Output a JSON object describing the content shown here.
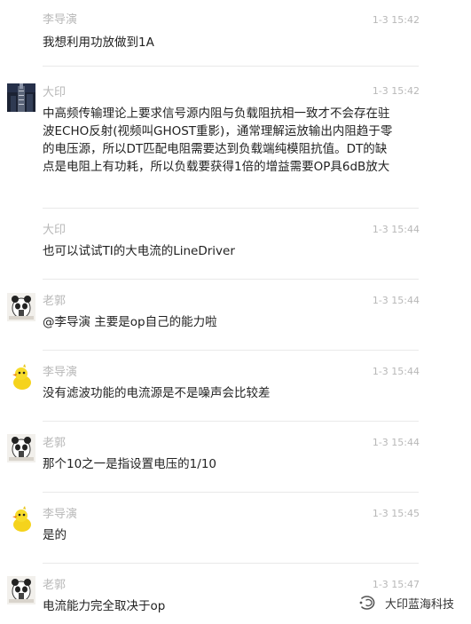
{
  "messages": [
    {
      "name": "李导演",
      "time": "1-3 15:42",
      "text": "我想利用功放做到1A",
      "avatar": "none"
    },
    {
      "name": "大印",
      "time": "1-3 15:42",
      "text": "中高频传输理论上要求信号源内阻与负载阻抗相一致才不会存在驻波ECHO反射(视频叫GHOST重影)，通常理解运放输出内阻趋于零的电压源，所以DT匹配电阻需要达到负载端纯模阻抗值。DT的缺点是电阻上有功耗，所以负载要获得1倍的增益需要OP具6dB放大",
      "avatar": "building-photo"
    },
    {
      "name": "大印",
      "time": "1-3 15:44",
      "text": "也可以试试TI的大电流的LineDriver",
      "avatar": "none"
    },
    {
      "name": "老郭",
      "time": "1-3 15:44",
      "text": "@李导演 主要是op自己的能力啦",
      "avatar": "panda-meme"
    },
    {
      "name": "李导演",
      "time": "1-3 15:44",
      "text": "没有滤波功能的电流源是不是噪声会比较差",
      "avatar": "yellow-duck"
    },
    {
      "name": "老郭",
      "time": "1-3 15:44",
      "text": "那个10之一是指设置电压的1/10",
      "avatar": "panda-meme"
    },
    {
      "name": "李导演",
      "time": "1-3 15:45",
      "text": "是的",
      "avatar": "yellow-duck"
    },
    {
      "name": "老郭",
      "time": "1-3 15:47",
      "text": "电流能力完全取决于op",
      "avatar": "panda-meme"
    }
  ],
  "watermark": {
    "text": "大印蓝海科技",
    "icon": "wechat-official-account-icon"
  },
  "colors": {
    "meta": "#b8b8b8",
    "text": "#222222",
    "divider": "#e9e9e9"
  }
}
